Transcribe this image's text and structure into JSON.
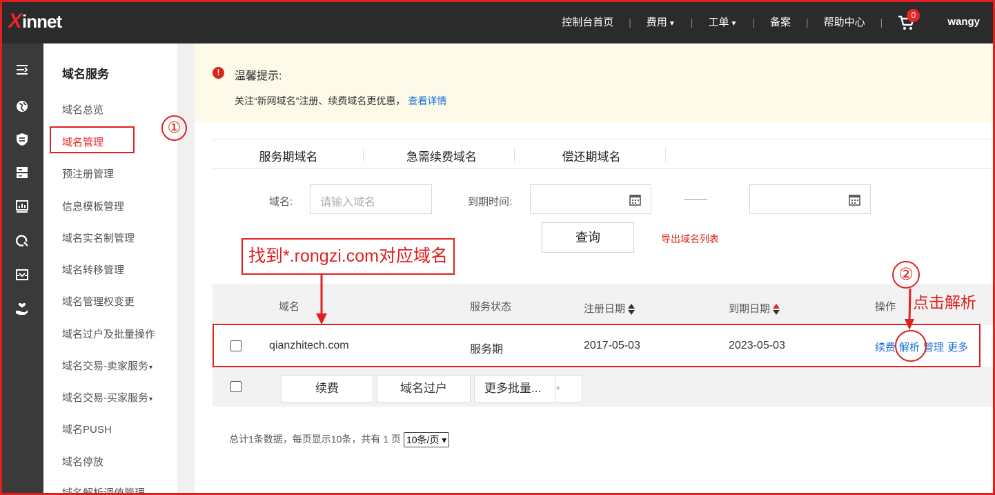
{
  "topbar": {
    "logo_x": "X",
    "logo_rest": "innet",
    "nav": [
      "控制台首页",
      "费用",
      "工单",
      "备案",
      "帮助中心"
    ],
    "separator": "|",
    "cart_count": "0",
    "username": "wangy"
  },
  "colors": {
    "brand_red": "#e8262a",
    "link_blue": "#1a6fd1",
    "topbar_bg": "#2b2b2b",
    "notice_bg": "#fdfaea"
  },
  "sidebar_icons": [
    "collapse-icon",
    "globe-icon",
    "shield-icon",
    "server-icon",
    "monitor-chart-icon",
    "cloud-sync-icon",
    "inbox-icon",
    "hand-heart-icon"
  ],
  "menu": {
    "title": "域名服务",
    "items": [
      "域名总览",
      "域名管理",
      "预注册管理",
      "信息模板管理",
      "域名实名制管理",
      "域名转移管理",
      "域名管理权变更",
      "域名过户及批量操作",
      "域名交易-卖家服务",
      "域名交易-买家服务",
      "域名PUSH",
      "域名停放",
      "域名解析调值管理"
    ],
    "dropdown_marker": "▾",
    "active_index": 1
  },
  "notice": {
    "icon": "!",
    "title": "温馨提示:",
    "text": "关注“新网域名”注册、续费域名更优惠，",
    "link": "查看详情"
  },
  "tabs": [
    "服务期域名",
    "急需续费域名",
    "偿还期域名"
  ],
  "filters": {
    "domain_label": "域名:",
    "domain_placeholder": "请输入域名",
    "expire_label": "到期时间:",
    "query_button": "查询",
    "export_link": "导出域名列表"
  },
  "table": {
    "headers": [
      "域名",
      "服务状态",
      "注册日期",
      "到期日期",
      "操作"
    ],
    "rows": [
      {
        "domain": "qianzhitech.com",
        "status": "服务期",
        "reg_date": "2017-05-03",
        "exp_date": "2023-05-03",
        "ops": [
          "续费",
          "解析",
          "管理",
          "更多"
        ]
      }
    ]
  },
  "batch": {
    "renew": "续费",
    "transfer": "域名过户",
    "more": "更多批量...",
    "more_caret": "▾"
  },
  "pagination": {
    "summary": "总计1条数据，每页显示10条，共有 1 页",
    "page_size": "10条/页 ▾"
  },
  "annotations": {
    "step1": "①",
    "step2": "②",
    "find_text": "找到*.rongzi.com对应域名",
    "click_text": "点击解析"
  }
}
